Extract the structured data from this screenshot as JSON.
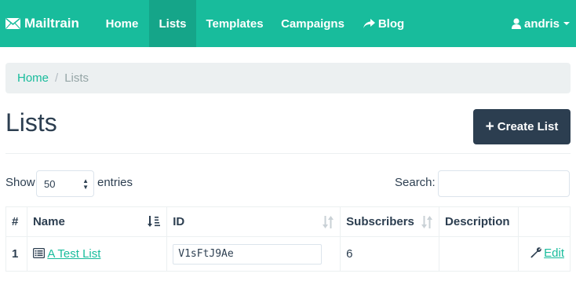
{
  "navbar": {
    "brand": "Mailtrain",
    "items": [
      {
        "label": "Home"
      },
      {
        "label": "Lists"
      },
      {
        "label": "Templates"
      },
      {
        "label": "Campaigns"
      },
      {
        "label": "Blog"
      }
    ],
    "active_item": "Lists",
    "user": "andris"
  },
  "breadcrumb": {
    "home": "Home",
    "current": "Lists"
  },
  "page": {
    "title": "Lists",
    "create_button": "Create List"
  },
  "controls": {
    "show_label": "Show",
    "entries_value": "50",
    "entries_label": "entries",
    "search_label": "Search:",
    "search_value": ""
  },
  "table": {
    "headers": {
      "num": "#",
      "name": "Name",
      "id": "ID",
      "subscribers": "Subscribers",
      "description": "Description"
    },
    "rows": [
      {
        "num": "1",
        "name": "A Test List",
        "id": "V1sFtJ9Ae",
        "subscribers": "6",
        "description": "",
        "action": "Edit"
      }
    ]
  },
  "colors": {
    "primary": "#18bc9c",
    "primary_active": "#15a589",
    "dark": "#2c3e50",
    "breadcrumb_bg": "#ecf0f1"
  }
}
